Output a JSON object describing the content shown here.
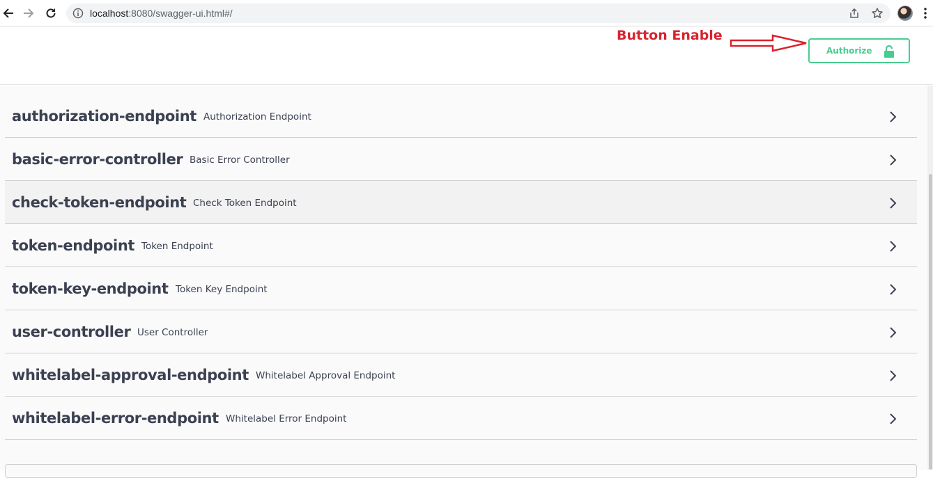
{
  "browser": {
    "url_host": "localhost",
    "url_rest": ":8080/swagger-ui.html#/"
  },
  "annotation": {
    "text": "Button Enable",
    "color": "#d9232d"
  },
  "authorize": {
    "label": "Authorize",
    "color": "#49cc90"
  },
  "tags": [
    {
      "name": "authorization-endpoint",
      "description": "Authorization Endpoint"
    },
    {
      "name": "basic-error-controller",
      "description": "Basic Error Controller"
    },
    {
      "name": "check-token-endpoint",
      "description": "Check Token Endpoint"
    },
    {
      "name": "token-endpoint",
      "description": "Token Endpoint"
    },
    {
      "name": "token-key-endpoint",
      "description": "Token Key Endpoint"
    },
    {
      "name": "user-controller",
      "description": "User Controller"
    },
    {
      "name": "whitelabel-approval-endpoint",
      "description": "Whitelabel Approval Endpoint"
    },
    {
      "name": "whitelabel-error-endpoint",
      "description": "Whitelabel Error Endpoint"
    }
  ],
  "icons": [
    "back-icon",
    "forward-icon",
    "reload-icon",
    "info-icon",
    "share-icon",
    "star-icon",
    "profile-avatar",
    "more-icon",
    "lock-icon",
    "chevron-right-icon"
  ]
}
